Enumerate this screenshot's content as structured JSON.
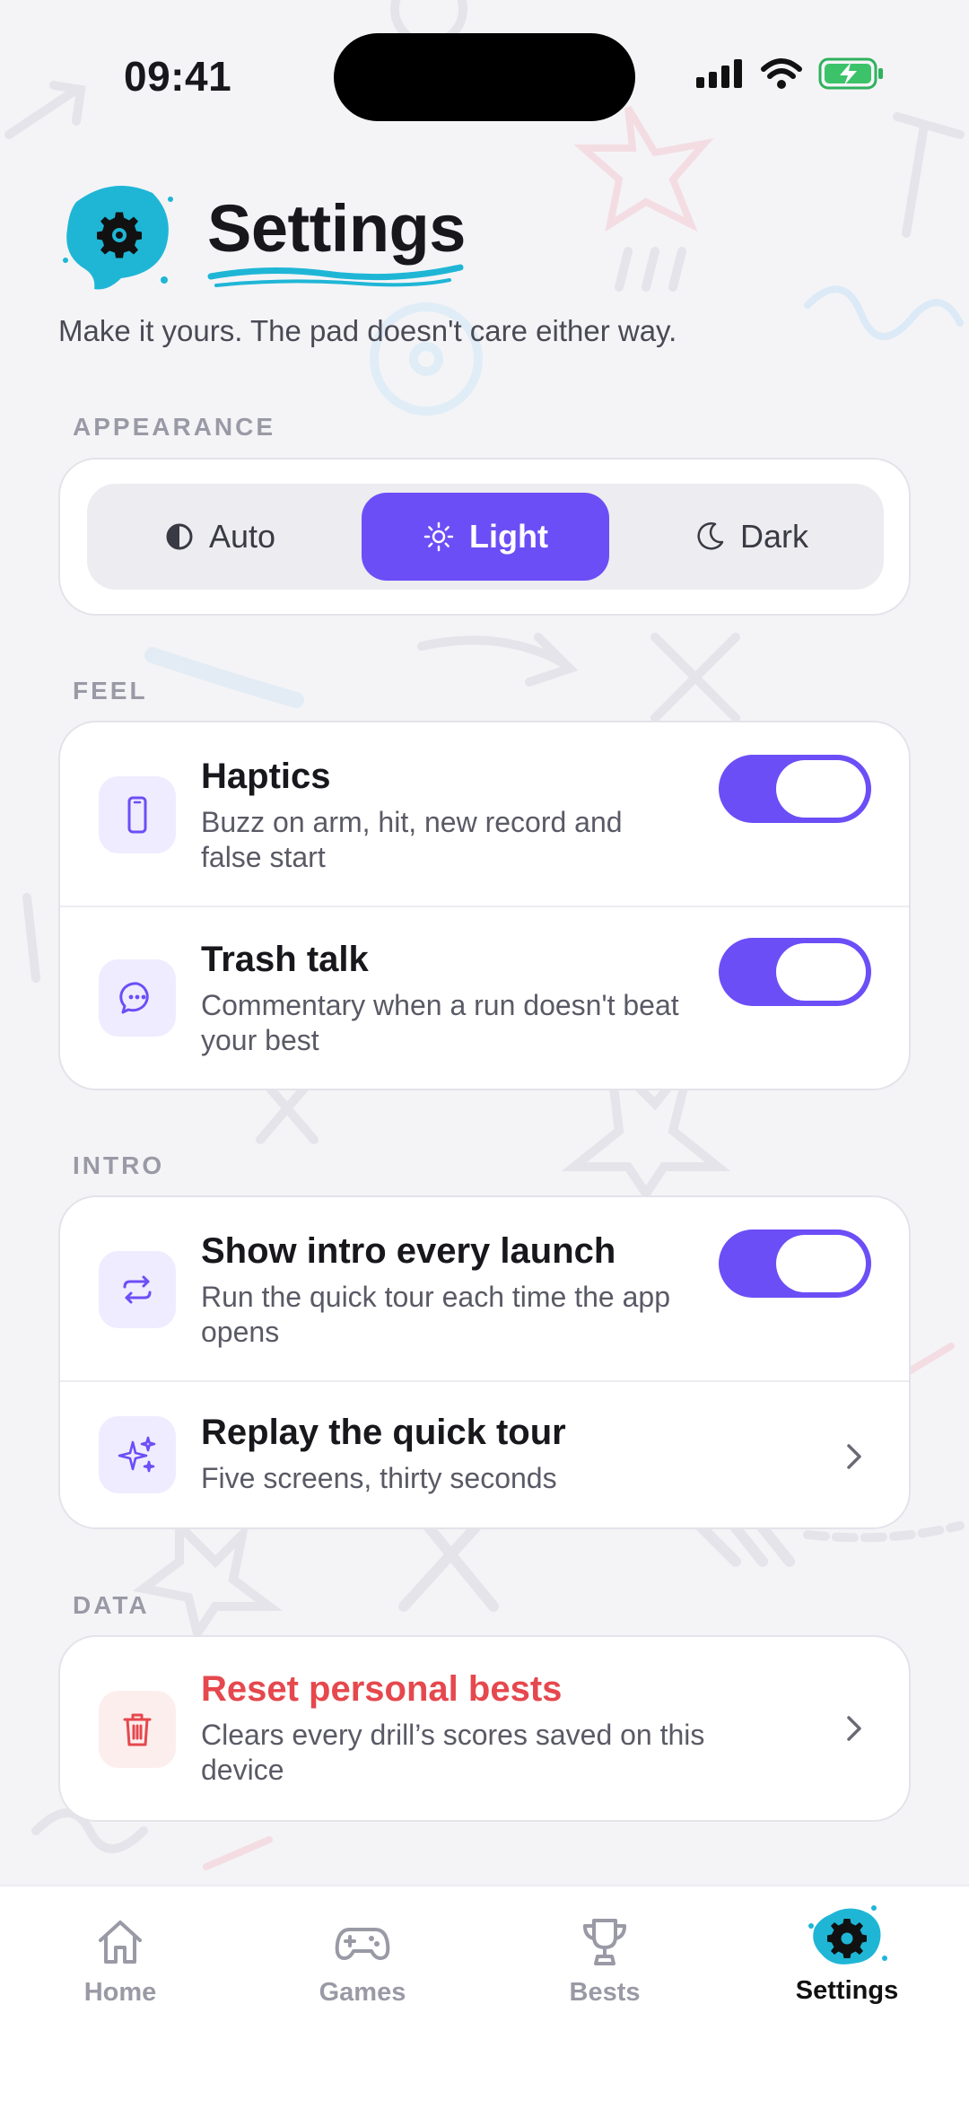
{
  "status_bar": {
    "time": "09:41"
  },
  "header": {
    "title": "Settings",
    "subtitle": "Make it yours. The pad doesn't care either way."
  },
  "appearance": {
    "label": "APPEARANCE",
    "options": [
      {
        "label": "Auto",
        "icon": "half-circle-icon"
      },
      {
        "label": "Light",
        "icon": "sun-icon"
      },
      {
        "label": "Dark",
        "icon": "moon-icon"
      }
    ],
    "selected": "Light"
  },
  "feel": {
    "label": "FEEL",
    "items": [
      {
        "title": "Haptics",
        "desc": "Buzz on arm, hit, new record and false start",
        "icon": "phone-icon",
        "toggle": true
      },
      {
        "title": "Trash talk",
        "desc": "Commentary when a run doesn't beat your best",
        "icon": "chat-bubble-icon",
        "toggle": true
      }
    ]
  },
  "intro": {
    "label": "INTRO",
    "items": [
      {
        "title": "Show intro every launch",
        "desc": "Run the quick tour each time the app opens",
        "icon": "repeat-icon",
        "toggle": true
      },
      {
        "title": "Replay the quick tour",
        "desc": "Five screens, thirty seconds",
        "icon": "sparkles-icon",
        "chevron": true
      }
    ]
  },
  "data": {
    "label": "DATA",
    "items": [
      {
        "title": "Reset personal bests",
        "desc": "Clears every drill’s scores saved on this device",
        "icon": "trash-icon",
        "chevron": true
      }
    ]
  },
  "tabbar": {
    "tabs": [
      {
        "label": "Home",
        "icon": "home-icon"
      },
      {
        "label": "Games",
        "icon": "gamepad-icon"
      },
      {
        "label": "Bests",
        "icon": "trophy-icon"
      },
      {
        "label": "Settings",
        "icon": "gear-icon"
      }
    ],
    "active": "Settings"
  },
  "colors": {
    "accent": "#6c4ef6",
    "brand_blob": "#1fb6d6",
    "danger": "#e5484d",
    "background": "#f4f4f7"
  }
}
